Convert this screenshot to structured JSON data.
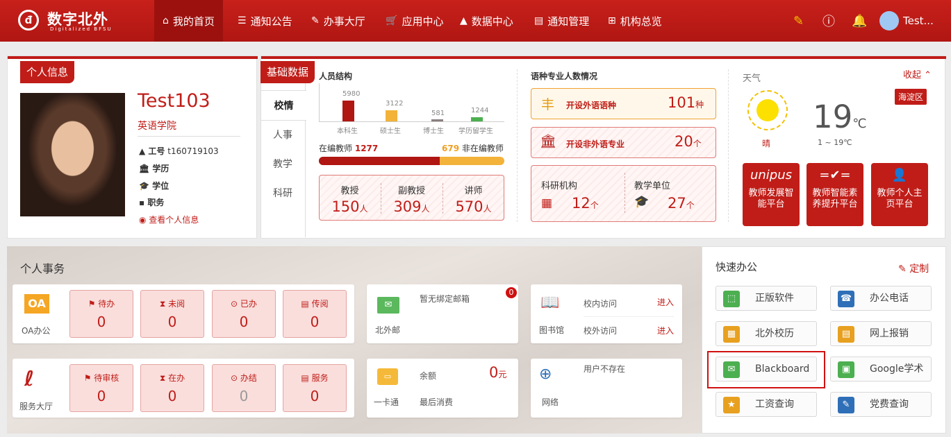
{
  "app": {
    "logo_mark": "đ",
    "logo_name": "数字北外",
    "logo_sub": "Digitalized BFSU"
  },
  "nav": [
    {
      "label": "我的首页",
      "icon": "home-icon"
    },
    {
      "label": "通知公告",
      "icon": "list-icon"
    },
    {
      "label": "办事大厅",
      "icon": "edit-icon"
    },
    {
      "label": "应用中心",
      "icon": "cart-icon"
    },
    {
      "label": "数据中心",
      "icon": "chart-icon"
    },
    {
      "label": "通知管理",
      "icon": "document-icon"
    },
    {
      "label": "机构总览",
      "icon": "org-icon"
    }
  ],
  "user": {
    "name": "Test..."
  },
  "profile": {
    "tag": "个人信息",
    "name": "Test103",
    "college": "英语学院",
    "id_label": "工号",
    "id_value": "t160719103",
    "degree_label": "学历",
    "title_label": "学位",
    "post_label": "职务",
    "link": "查看个人信息"
  },
  "basic": {
    "tag": "基础数据",
    "tabs": [
      "校情",
      "人事",
      "教学",
      "科研"
    ],
    "staff_title": "人员结构",
    "bars": [
      {
        "label": "本科生",
        "value": "5980"
      },
      {
        "label": "硕士生",
        "value": "3122"
      },
      {
        "label": "博士生",
        "value": "581"
      },
      {
        "label": "学历留学生",
        "value": "1244"
      }
    ],
    "teacher_in_label": "在编教师",
    "teacher_in_value": "1277",
    "teacher_out_value": "679",
    "teacher_out_label": "非在编教师",
    "teacher_ratio": 0.653,
    "ranks": [
      {
        "label": "教授",
        "value": "150",
        "unit": "人"
      },
      {
        "label": "副教授",
        "value": "309",
        "unit": "人"
      },
      {
        "label": "讲师",
        "value": "570",
        "unit": "人"
      }
    ],
    "lang_title": "语种专业人数情况",
    "lang_row1": {
      "label": "开设外语语种",
      "value": "101",
      "unit": "种"
    },
    "lang_row2": {
      "label": "开设非外语专业",
      "value": "20",
      "unit": "个"
    },
    "inst_label": "科研机构",
    "inst_value": "12",
    "inst_unit": "个",
    "unit_label": "教学单位",
    "unit_value": "27",
    "unit_unit": "个"
  },
  "weather": {
    "title": "天气",
    "collapse": "收起",
    "district": "海淀区",
    "condition": "晴",
    "temp": "19",
    "temp_unit": "℃",
    "range": "1 ~ 19℃"
  },
  "platforms": [
    {
      "label": "教师发展智能平台",
      "icon_text": "unipus"
    },
    {
      "label": "教师智能素养提升平台",
      "icon_text": "=✔="
    },
    {
      "label": "教师个人主页平台",
      "icon_text": "👤"
    }
  ],
  "personal": {
    "title": "个人事务",
    "oa": {
      "label": "OA办公",
      "logo": "OA"
    },
    "oa_stats": [
      {
        "label": "待办",
        "value": "0"
      },
      {
        "label": "未阅",
        "value": "0"
      },
      {
        "label": "已办",
        "value": "0"
      },
      {
        "label": "传阅",
        "value": "0"
      }
    ],
    "service": {
      "label": "服务大厅"
    },
    "service_stats": [
      {
        "label": "待审核",
        "value": "0"
      },
      {
        "label": "在办",
        "value": "0"
      },
      {
        "label": "办结",
        "value": "0"
      },
      {
        "label": "服务",
        "value": "0"
      }
    ],
    "mail": {
      "label": "北外邮",
      "text": "暂无绑定邮箱",
      "badge": "0"
    },
    "library": {
      "label": "图书馆",
      "row1": "校内访问",
      "row2": "校外访问",
      "enter": "进入"
    },
    "card": {
      "label": "一卡通",
      "balance_label": "余额",
      "balance_value": "0",
      "balance_unit": "元",
      "last_label": "最后消费"
    },
    "network": {
      "label": "网络",
      "text": "用户不存在"
    }
  },
  "quick": {
    "title": "快速办公",
    "customize": "定制",
    "items": [
      {
        "label": "正版软件",
        "color": "#4caf50"
      },
      {
        "label": "办公电话",
        "color": "#2f6fb8"
      },
      {
        "label": "北外校历",
        "color": "#e8a020"
      },
      {
        "label": "网上报销",
        "color": "#e8a020"
      },
      {
        "label": "Blackboard",
        "color": "#4caf50"
      },
      {
        "label": "Google学术",
        "color": "#4caf50"
      },
      {
        "label": "工资查询",
        "color": "#e8a020"
      },
      {
        "label": "党费查询",
        "color": "#2f6fb8"
      }
    ]
  }
}
